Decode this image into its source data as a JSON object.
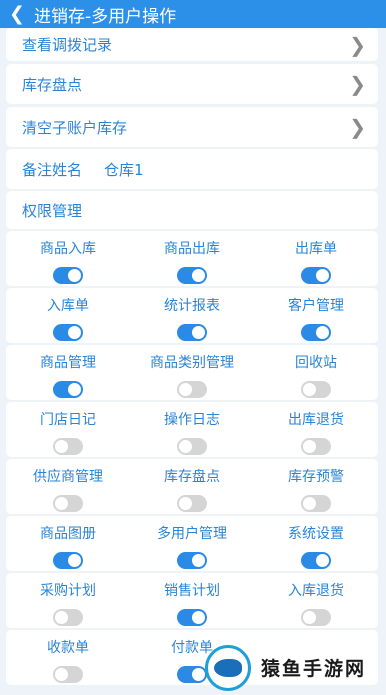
{
  "header": {
    "back_icon": "chevron-left-icon",
    "title": "进销存-多用户操作"
  },
  "menu": [
    {
      "label": "查看调拨记录"
    },
    {
      "label": "库存盘点"
    },
    {
      "label": "清空子账户库存"
    }
  ],
  "note": {
    "label": "备注姓名",
    "value": "仓库1"
  },
  "permissions": {
    "title": "权限管理",
    "items": [
      {
        "label": "商品入库",
        "on": true
      },
      {
        "label": "商品出库",
        "on": true
      },
      {
        "label": "出库单",
        "on": true
      },
      {
        "label": "入库单",
        "on": true
      },
      {
        "label": "统计报表",
        "on": true
      },
      {
        "label": "客户管理",
        "on": true
      },
      {
        "label": "商品管理",
        "on": true
      },
      {
        "label": "商品类别管理",
        "on": false
      },
      {
        "label": "回收站",
        "on": false
      },
      {
        "label": "门店日记",
        "on": false
      },
      {
        "label": "操作日志",
        "on": false
      },
      {
        "label": "出库退货",
        "on": false
      },
      {
        "label": "供应商管理",
        "on": false
      },
      {
        "label": "库存盘点",
        "on": false
      },
      {
        "label": "库存预警",
        "on": false
      },
      {
        "label": "商品图册",
        "on": true
      },
      {
        "label": "多用户管理",
        "on": true
      },
      {
        "label": "系统设置",
        "on": true
      },
      {
        "label": "采购计划",
        "on": false
      },
      {
        "label": "销售计划",
        "on": true
      },
      {
        "label": "入库退货",
        "on": false
      },
      {
        "label": "收款单",
        "on": false
      },
      {
        "label": "付款单",
        "on": true
      }
    ]
  },
  "watermark": {
    "text": "猿鱼手游网"
  },
  "colors": {
    "header": "#2d90e8",
    "accent": "#2b8ae6",
    "toggle_off": "#d5d5d5",
    "text": "#2a84d7"
  }
}
